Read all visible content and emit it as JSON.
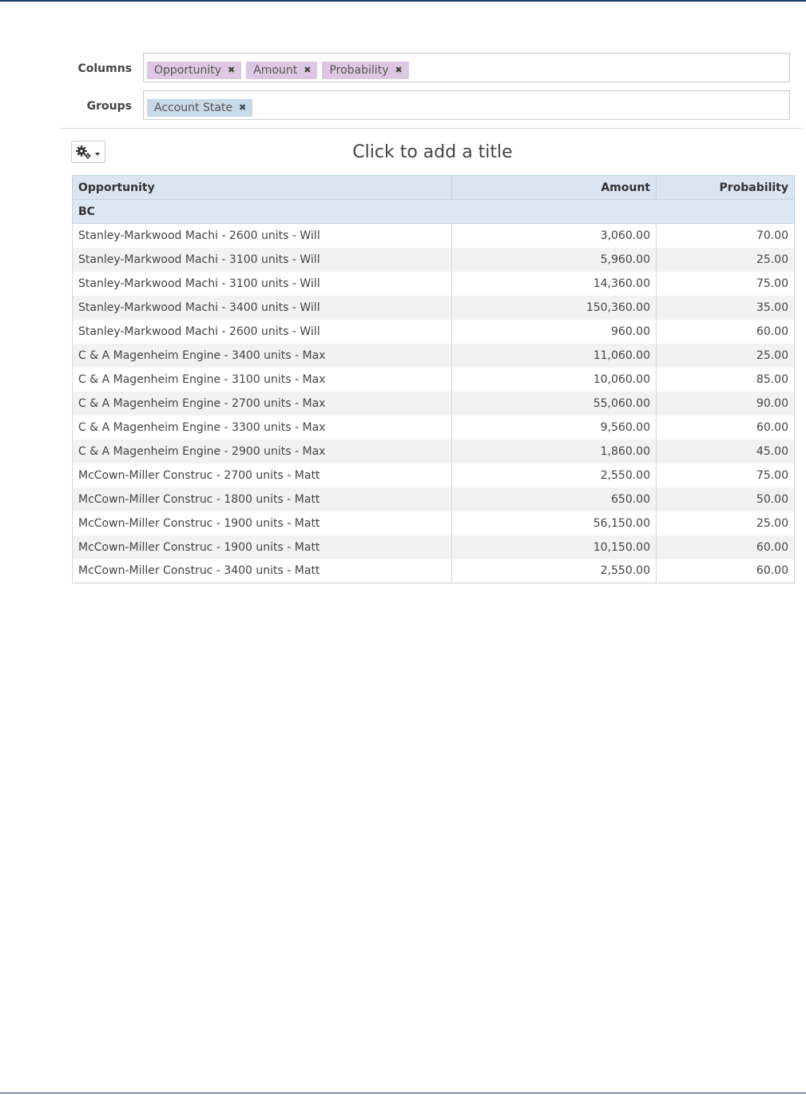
{
  "builder": {
    "columns_label": "Columns",
    "columns": [
      "Opportunity",
      "Amount",
      "Probability"
    ],
    "groups_label": "Groups",
    "groups": [
      "Account State"
    ]
  },
  "report": {
    "title_placeholder": "Click to add a title",
    "headers": [
      "Opportunity",
      "Amount",
      "Probability"
    ],
    "group_name": "BC",
    "rows": [
      [
        "Stanley-Markwood Machi - 2600 units - Will",
        "3,060.00",
        "70.00"
      ],
      [
        "Stanley-Markwood Machi - 3100 units - Will",
        "5,960.00",
        "25.00"
      ],
      [
        "Stanley-Markwood Machi - 3100 units - Will",
        "14,360.00",
        "75.00"
      ],
      [
        "Stanley-Markwood Machi - 3400 units - Will",
        "150,360.00",
        "35.00"
      ],
      [
        "Stanley-Markwood Machi - 2600 units - Will",
        "960.00",
        "60.00"
      ],
      [
        "C & A Magenheim Engine - 3400 units - Max",
        "11,060.00",
        "25.00"
      ],
      [
        "C & A Magenheim Engine - 3100 units - Max",
        "10,060.00",
        "85.00"
      ],
      [
        "C & A Magenheim Engine - 2700 units - Max",
        "55,060.00",
        "90.00"
      ],
      [
        "C & A Magenheim Engine - 3300 units - Max",
        "9,560.00",
        "60.00"
      ],
      [
        "C & A Magenheim Engine - 2900 units - Max",
        "1,860.00",
        "45.00"
      ],
      [
        "McCown-Miller Construc - 2700 units - Matt",
        "2,550.00",
        "75.00"
      ],
      [
        "McCown-Miller Construc - 1800 units - Matt",
        "650.00",
        "50.00"
      ],
      [
        "McCown-Miller Construc - 1900 units - Matt",
        "56,150.00",
        "25.00"
      ],
      [
        "McCown-Miller Construc - 1900 units - Matt",
        "10,150.00",
        "60.00"
      ],
      [
        "McCown-Miller Construc - 3400 units - Matt",
        "2,550.00",
        "60.00"
      ]
    ]
  },
  "icons": {
    "remove": "close-icon",
    "settings": "gear-icon",
    "dropdown": "caret-down-icon"
  },
  "colors": {
    "column_chip": "#dcc8e2",
    "group_chip": "#c8d9e8",
    "header_bg": "#d9e5f0"
  }
}
